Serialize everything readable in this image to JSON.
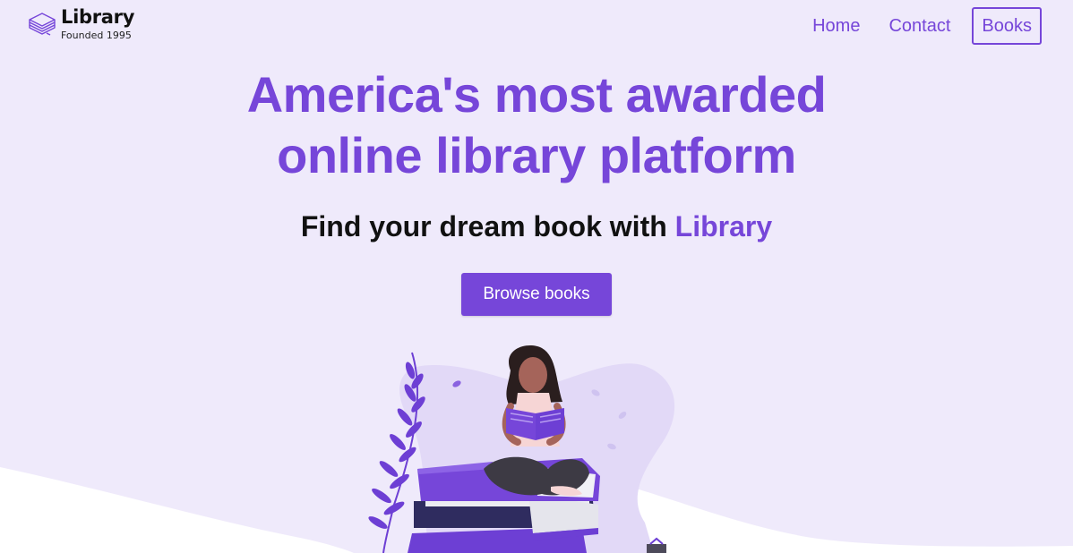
{
  "colors": {
    "accent": "#7646d9",
    "background": "#efeafb",
    "text_dark": "#111111"
  },
  "brand": {
    "name": "Library",
    "tagline": "Founded 1995",
    "icon": "stacked-books-icon"
  },
  "nav": {
    "items": [
      {
        "label": "Home"
      },
      {
        "label": "Contact"
      },
      {
        "label": "Books",
        "active": true
      }
    ]
  },
  "hero": {
    "title_line1": "America's most awarded",
    "title_line2": "online library platform",
    "subtitle_prefix": "Find your dream book with ",
    "subtitle_brand": "Library",
    "cta_label": "Browse books"
  },
  "illustration": {
    "icon": "woman-reading-on-books-illustration"
  }
}
